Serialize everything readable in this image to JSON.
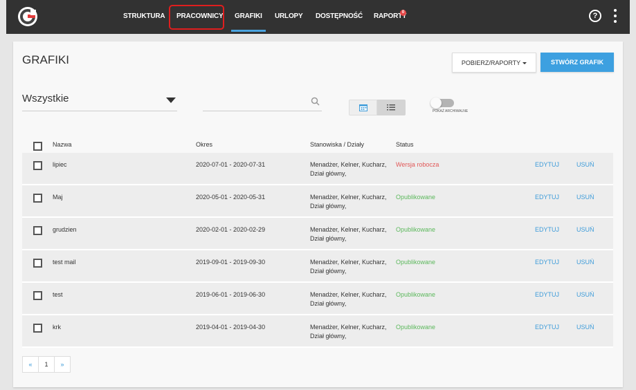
{
  "nav": {
    "items": [
      {
        "label": "STRUKTURA"
      },
      {
        "label": "PRACOWNICY"
      },
      {
        "label": "GRAFIKI"
      },
      {
        "label": "URLOPY"
      },
      {
        "label": "DOSTĘPNOŚĆ"
      },
      {
        "label": "RAPORTY"
      }
    ],
    "active": "GRAFIKI",
    "raporty_badge": "0",
    "help_label": "?"
  },
  "page": {
    "title": "GRAFIKI",
    "btn_raporty": "POBIERZ/RAPORTY",
    "btn_create": "STWÓRZ GRAFIK"
  },
  "filters": {
    "select_value": "Wszystkie",
    "search_value": "",
    "archive_label": "POKAŻ ARCHIWALNE"
  },
  "table": {
    "headers": {
      "name": "Nazwa",
      "okres": "Okres",
      "stanowiska": "Stanowiska / Działy",
      "status": "Status"
    },
    "rows": [
      {
        "name": "lipiec",
        "okres": "2020-07-01 - 2020-07-31",
        "stanowiska": "Menadżer, Kelner, Kucharz, Dział główny,",
        "status": "Wersja robocza",
        "edit": "EDYTUJ",
        "del": "USUŃ"
      },
      {
        "name": "Maj",
        "okres": "2020-05-01 - 2020-05-31",
        "stanowiska": "Menadżer, Kelner, Kucharz, Dział główny,",
        "status": "Opublikowane",
        "edit": "EDYTUJ",
        "del": "USUŃ"
      },
      {
        "name": "grudzien",
        "okres": "2020-02-01 - 2020-02-29",
        "stanowiska": "Menadżer, Kelner, Kucharz, Dział główny,",
        "status": "Opublikowane",
        "edit": "EDYTUJ",
        "del": "USUŃ"
      },
      {
        "name": "test mail",
        "okres": "2019-09-01 - 2019-09-30",
        "stanowiska": "Menadżer, Kelner, Kucharz, Dział główny,",
        "status": "Opublikowane",
        "edit": "EDYTUJ",
        "del": "USUŃ"
      },
      {
        "name": "test",
        "okres": "2019-06-01 - 2019-06-30",
        "stanowiska": "Menadżer, Kelner, Kucharz, Dział główny,",
        "status": "Opublikowane",
        "edit": "EDYTUJ",
        "del": "USUŃ"
      },
      {
        "name": "krk",
        "okres": "2019-04-01 - 2019-04-30",
        "stanowiska": "Menadżer, Kelner, Kucharz, Dział główny,",
        "status": "Opublikowane",
        "edit": "EDYTUJ",
        "del": "USUŃ"
      }
    ]
  },
  "pagination": {
    "prev": "«",
    "current": "1",
    "next": "»"
  },
  "colors": {
    "accent": "#3da0e0",
    "draft": "#e15656",
    "published": "#5cb85c",
    "topbar": "#323232"
  }
}
